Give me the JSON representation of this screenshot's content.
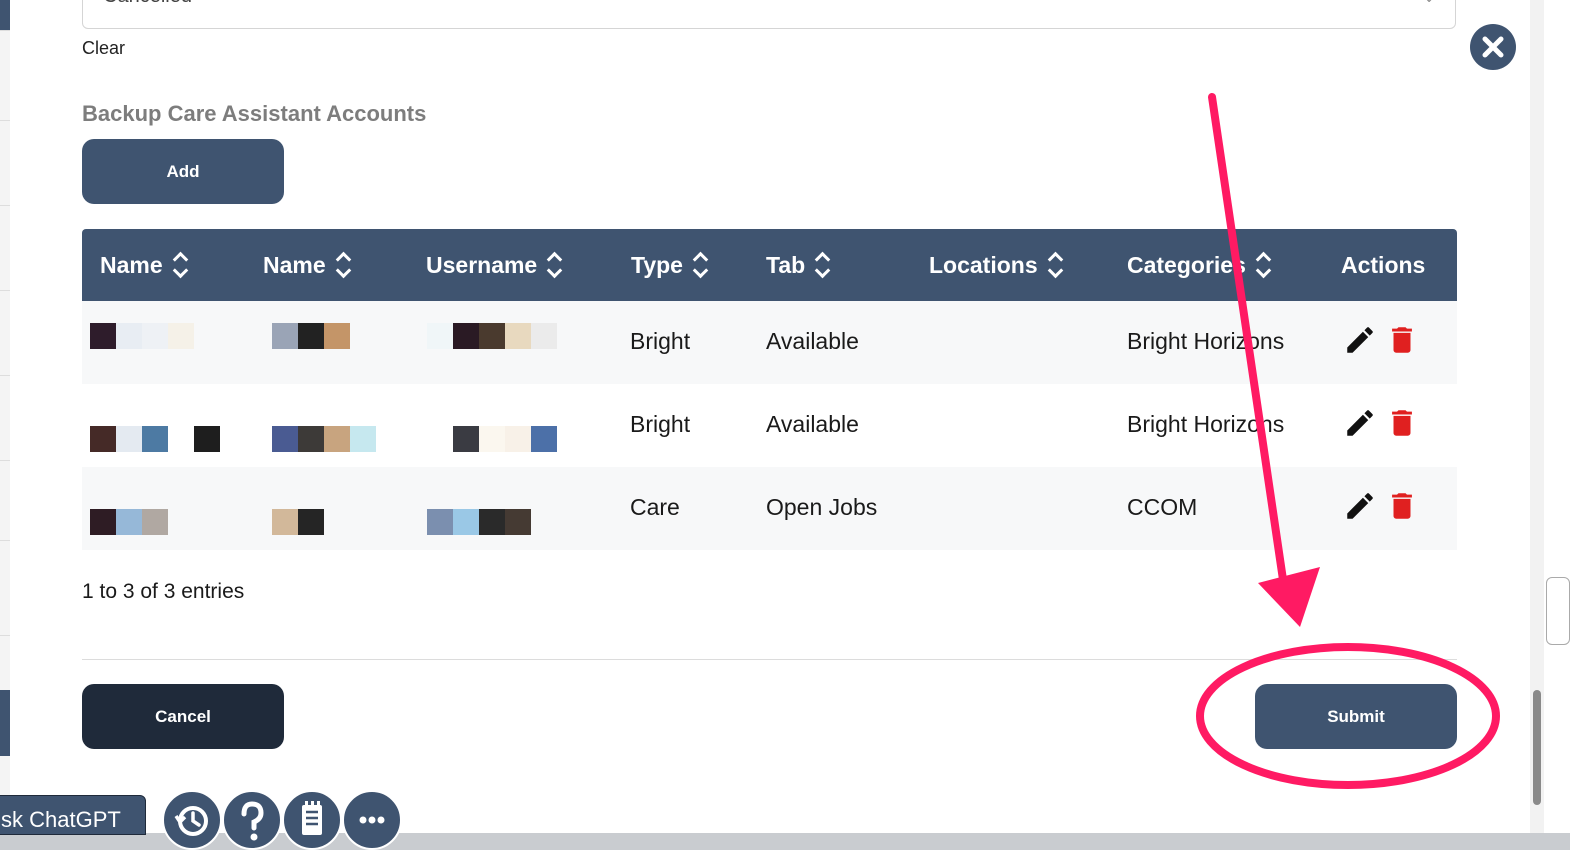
{
  "form": {
    "status_select_value": "Cancelled",
    "clear_label": "Clear"
  },
  "section": {
    "title": "Backup Care Assistant Accounts",
    "add_label": "Add"
  },
  "table": {
    "headers": [
      "Name",
      "Name",
      "Username",
      "Type",
      "Tab",
      "Locations",
      "Categories",
      "Actions"
    ],
    "rows": [
      {
        "type": "Bright",
        "tab": "Available",
        "locations": "",
        "category": "Bright Horizons"
      },
      {
        "type": "Bright",
        "tab": "Available",
        "locations": "",
        "category": "Bright Horizons"
      },
      {
        "type": "Care",
        "tab": "Open Jobs",
        "locations": "",
        "category": "CCOM"
      }
    ],
    "entries_label": "1 to 3 of 3 entries"
  },
  "footer": {
    "cancel_label": "Cancel",
    "submit_label": "Submit"
  },
  "toolbar": {
    "chatgpt_label": "sk ChatGPT",
    "icons": [
      "history-icon",
      "help-icon",
      "notes-icon",
      "more-icon"
    ]
  },
  "colors": {
    "primary": "#3f5470",
    "dark": "#1f2a3a",
    "delete": "#e02020",
    "annotation": "#ff1a63"
  }
}
